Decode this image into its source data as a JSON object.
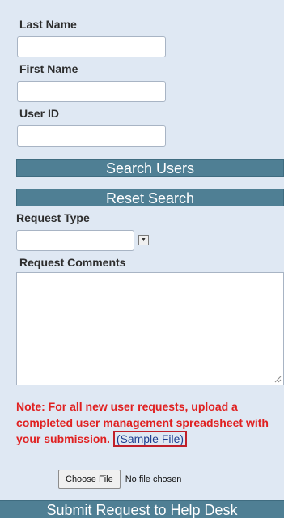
{
  "form": {
    "last_name_label": "Last Name",
    "last_name_value": "",
    "first_name_label": "First Name",
    "first_name_value": "",
    "user_id_label": "User ID",
    "user_id_value": "",
    "search_button": "Search Users",
    "reset_button": "Reset Search",
    "request_type_label": "Request Type",
    "request_type_value": "",
    "request_comments_label": "Request Comments",
    "request_comments_value": "",
    "note_text": "Note: For all new user requests, upload a completed user management spreadsheet with your submission.",
    "sample_file_link": "(Sample File)",
    "choose_file_button": "Choose File",
    "file_status": "No file chosen",
    "submit_button": "Submit Request to Help Desk"
  },
  "colors": {
    "panel_background": "#dfe8f3",
    "button_background": "#4f7f94",
    "note_text": "#e02020",
    "link_text": "#1e3d8f",
    "link_outline": "#c0202a"
  },
  "icons": {
    "select_arrow": "dropdown-arrow-icon",
    "textarea_grip": "resize-grip-icon"
  }
}
